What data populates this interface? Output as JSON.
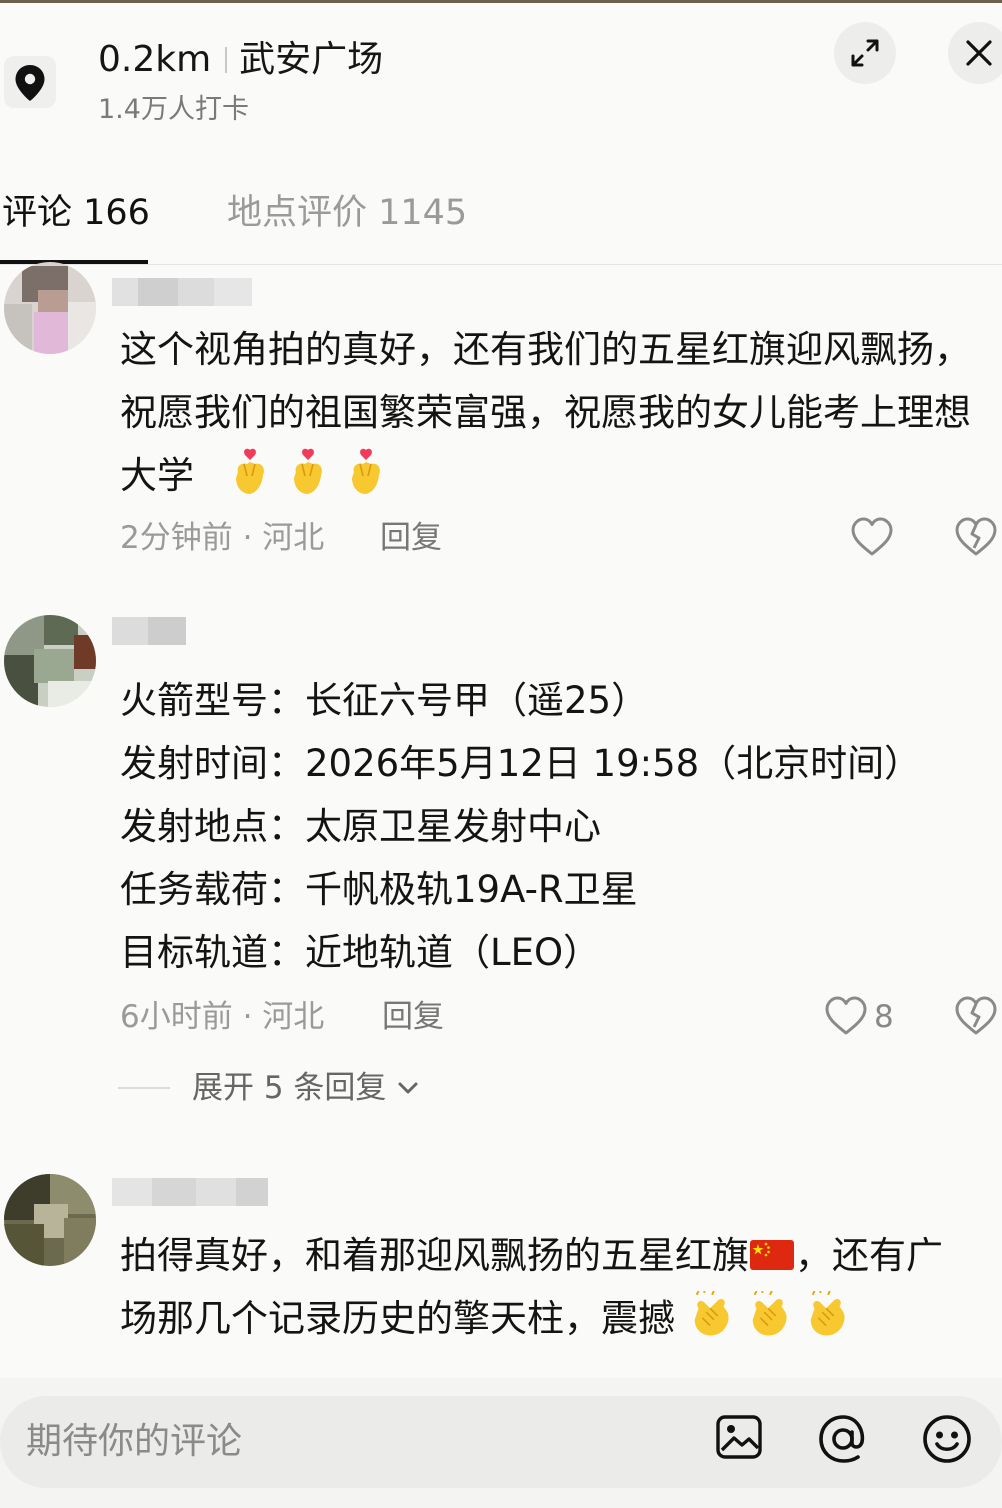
{
  "header": {
    "distance": "0.2km",
    "place_name": "武安广场",
    "checkins": "1.4万人打卡",
    "icons": [
      "location-pin-icon",
      "expand-icon",
      "close-icon"
    ]
  },
  "tabs": [
    {
      "label": "评论 166",
      "active": true
    },
    {
      "label": "地点评价 1145",
      "active": false
    }
  ],
  "comments": [
    {
      "lines": [
        "这个视角拍的真好，还有我们的五星红旗迎风飘扬，",
        "祝愿我们的祖国繁荣富强，祝愿我的女儿能考上理想",
        "大学"
      ],
      "emoji": [
        "finger-heart-emoji",
        "finger-heart-emoji",
        "finger-heart-emoji"
      ],
      "time_location": "2分钟前 · 河北",
      "reply": "回复",
      "likes": ""
    },
    {
      "lines": [
        "火箭型号：长征六号甲（遥25）",
        "发射时间：2026年5月12日 19:58（北京时间）",
        "发射地点：太原卫星发射中心",
        "任务载荷：千帆极轨19A-R卫星",
        "目标轨道：近地轨道（LEO）"
      ],
      "time_location": "6小时前 · 河北",
      "reply": "回复",
      "likes": "8",
      "expand_label": "展开 5 条回复"
    },
    {
      "line1_a": "拍得真好，和着那迎风飘扬的五星红旗",
      "line1_b": "，还有广",
      "line2": "场那几个记录历史的擎天柱，震撼",
      "emoji": [
        "china-flag-emoji",
        "clapping-hands-emoji",
        "clapping-hands-emoji",
        "clapping-hands-emoji"
      ]
    }
  ],
  "input": {
    "placeholder": "期待你的评论",
    "icons": [
      "image-icon",
      "at-icon",
      "emoji-icon"
    ]
  },
  "colors": {
    "background": "#fafaf8",
    "text": "#141414",
    "muted": "#9a9a9a",
    "accent_flag": "#de2910"
  }
}
